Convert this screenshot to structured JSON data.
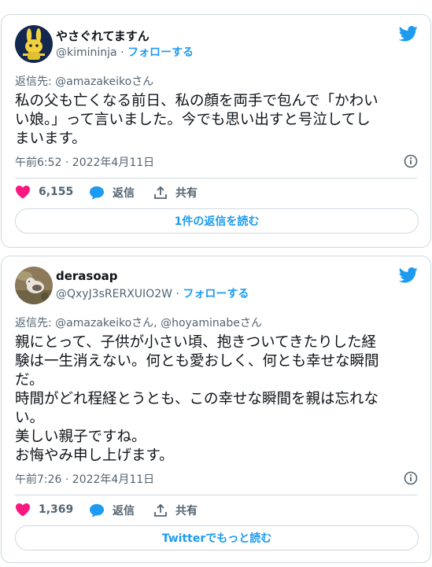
{
  "colors": {
    "accent": "#1d9bf0",
    "like": "#f91880",
    "muted": "#536471",
    "text": "#0f1419",
    "border": "#cfd9de"
  },
  "tweets": [
    {
      "display_name": "やさぐれてますん",
      "handle": "@kimininja",
      "separator": " · ",
      "follow_label": "フォローする",
      "reply_prefix": "返信先: ",
      "reply_to": "@amazakeikoさん",
      "body_lines": [
        "私の父も亡くなる前日、私の顔を両手で包んで「かわい",
        "い娘。」って言いました。今でも思い出すと号泣してし",
        "まいます。"
      ],
      "timestamp": "午前6:52 · 2022年4月11日",
      "likes": "6,155",
      "reply_label": "返信",
      "share_label": "共有",
      "more_button": "1件の返信を読む",
      "avatar_icon": "rabbit-avatar-icon"
    },
    {
      "display_name": "derasoap",
      "handle": "@QxyJ3sRERXUIO2W",
      "separator": " · ",
      "follow_label": "フォローする",
      "reply_prefix": "返信先: ",
      "reply_to": "@amazakeikoさん, @hoyaminabeさん",
      "body_lines": [
        "親にとって、子供が小さい頃、抱きついてきたりした経",
        "験は一生消えない。何とも愛おしく、何とも幸せな瞬間",
        "だ。",
        "時間がどれ程経とうとも、この幸せな瞬間を親は忘れな",
        "い。",
        "美しい親子ですね。",
        "お悔やみ申し上げます。"
      ],
      "timestamp": "午前7:26 · 2022年4月11日",
      "likes": "1,369",
      "reply_label": "返信",
      "share_label": "共有",
      "more_button": "Twitterでもっと読む",
      "avatar_icon": "cat-photo-avatar-icon"
    }
  ]
}
